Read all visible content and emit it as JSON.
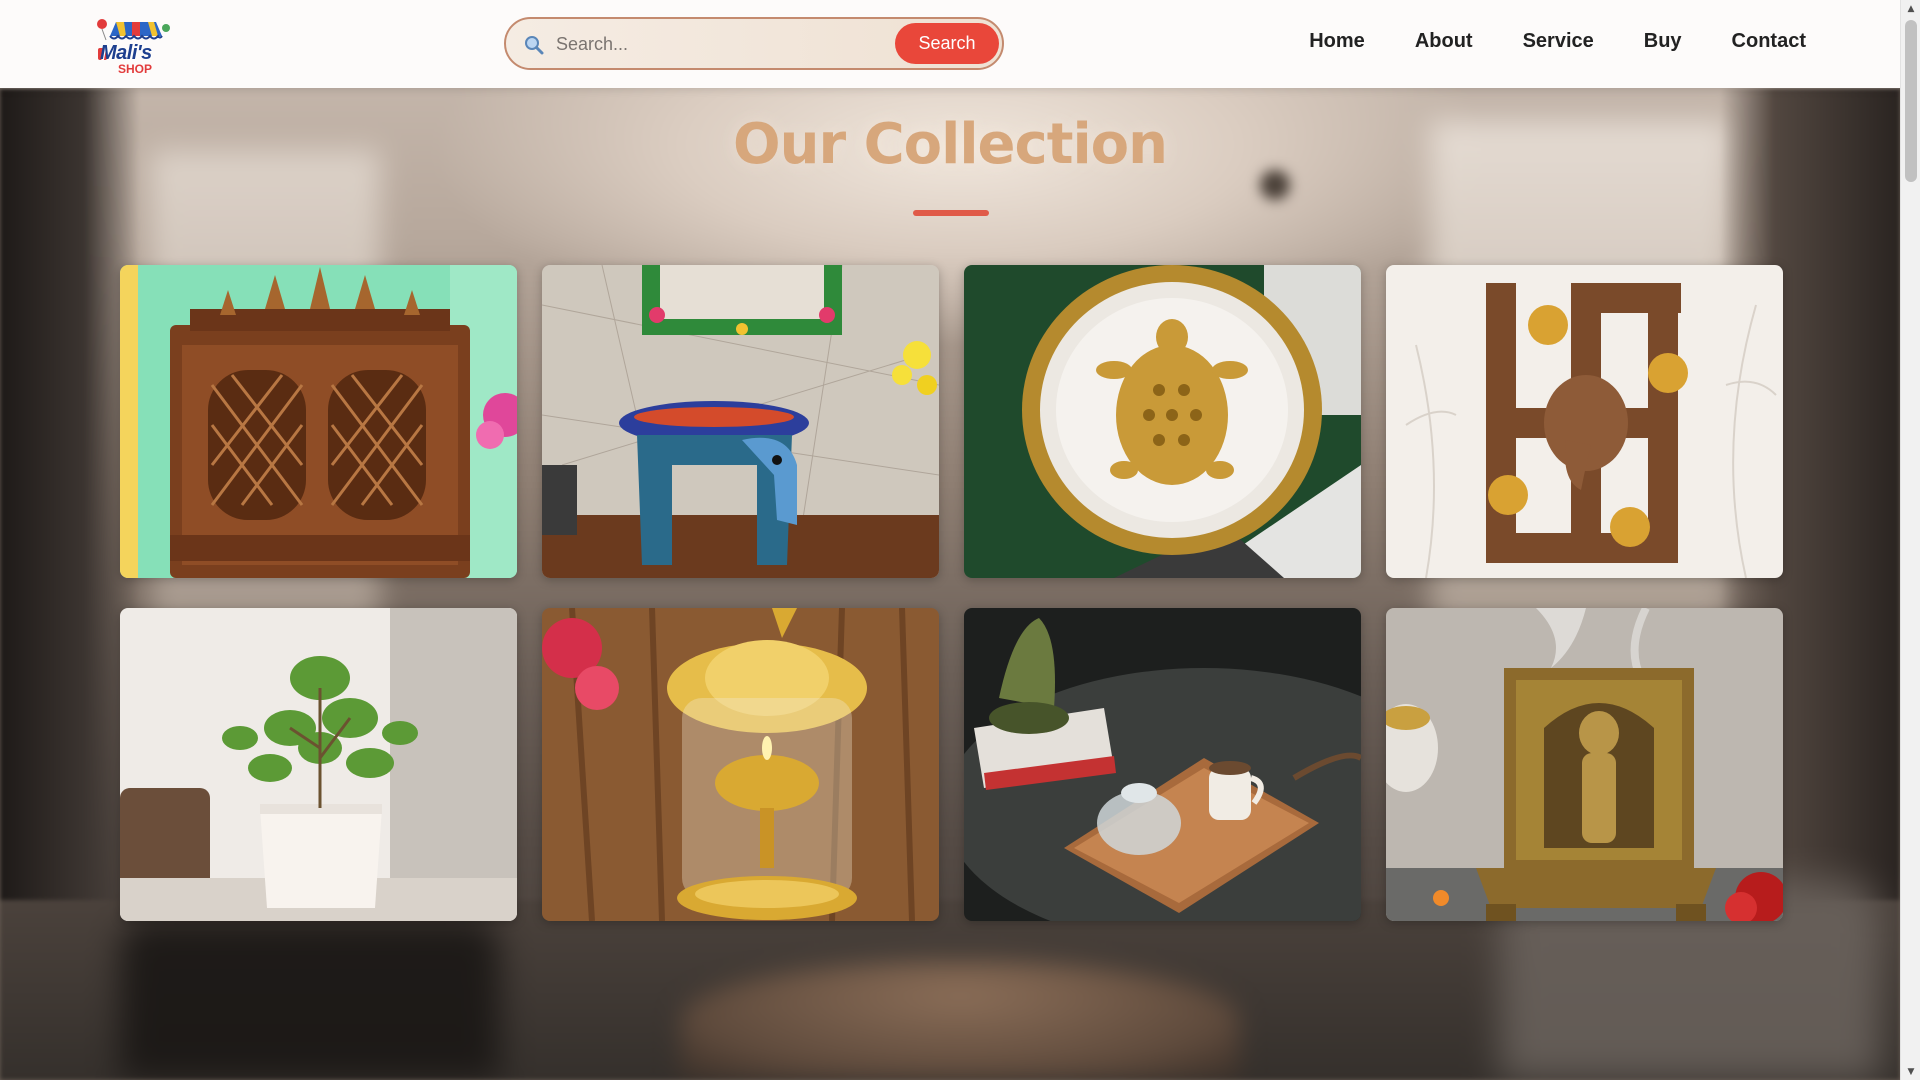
{
  "logo": {
    "text": "Mali's",
    "sub": "SHOP"
  },
  "search": {
    "placeholder": "Search...",
    "value": "",
    "button_label": "Search",
    "icon": "search-icon"
  },
  "nav": {
    "items": [
      {
        "label": "Home"
      },
      {
        "label": "About"
      },
      {
        "label": "Service"
      },
      {
        "label": "Buy"
      },
      {
        "label": "Contact"
      }
    ]
  },
  "collection": {
    "title": "Our Collection",
    "products": [
      {
        "image": "wooden-temple-image"
      },
      {
        "image": "painted-elephant-stool-image"
      },
      {
        "image": "brass-tortoise-plate-image"
      },
      {
        "image": "swastik-om-ganesha-wall-decor-image"
      },
      {
        "image": "jade-plant-pot-image"
      },
      {
        "image": "brass-akhand-diya-image"
      },
      {
        "image": "wooden-tray-tea-set-image"
      },
      {
        "image": "brass-deity-incense-holder-image"
      }
    ]
  },
  "colors": {
    "accent": "#e9473a",
    "title": "#d7a77c",
    "underline": "#e05a48",
    "header_bg": "#fdfbfa"
  }
}
